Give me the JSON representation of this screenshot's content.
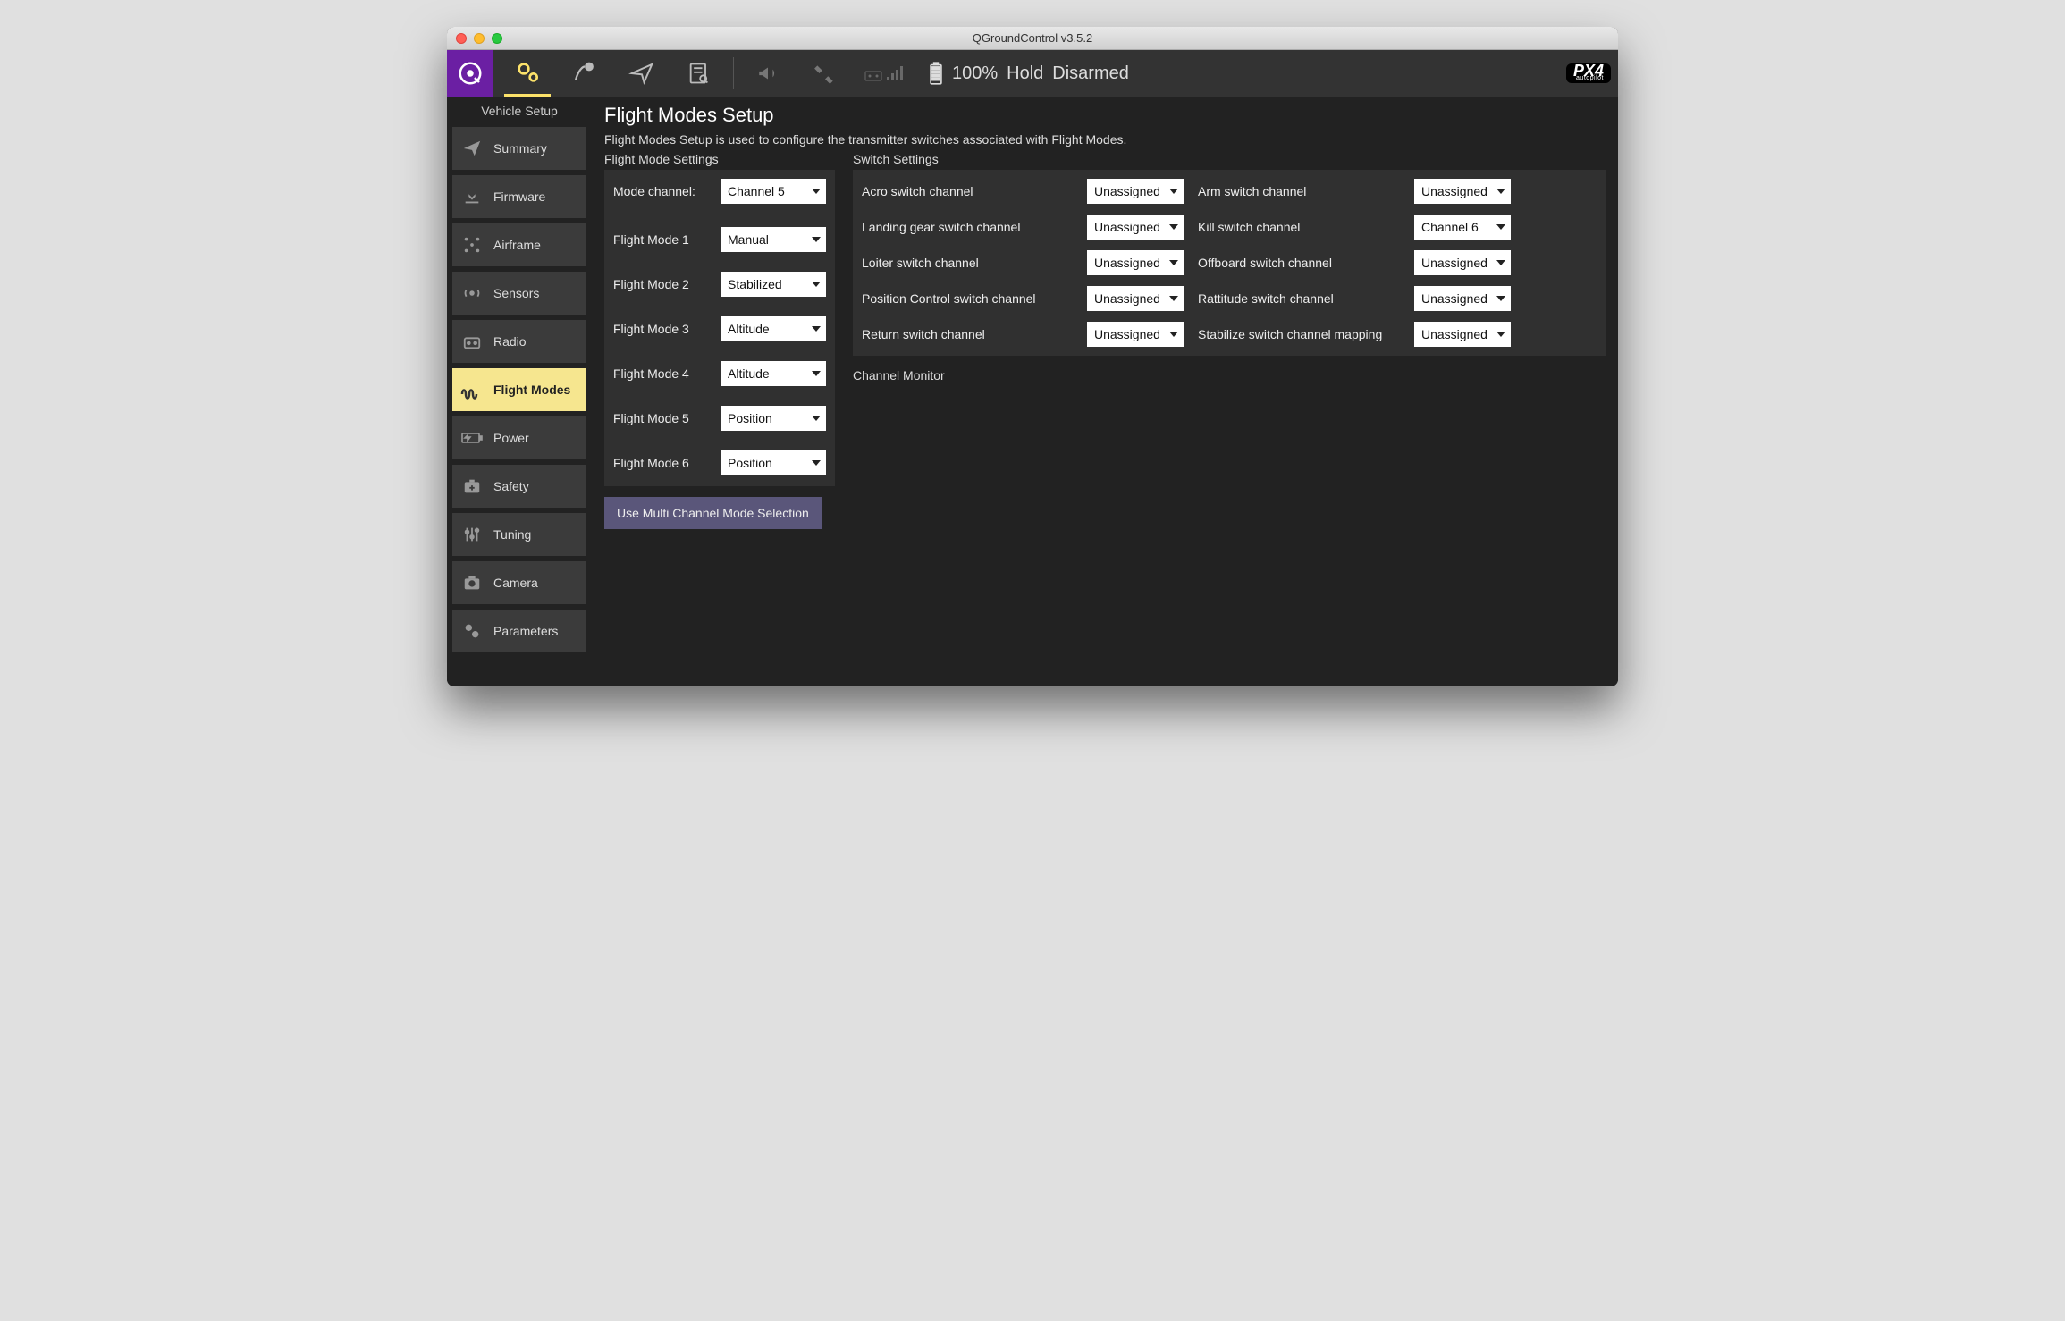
{
  "window": {
    "title": "QGroundControl v3.5.2"
  },
  "toolbar": {
    "battery": "100%",
    "status1": "Hold",
    "status2": "Disarmed",
    "brand": "PX4",
    "brand_sub": "autopilot"
  },
  "sidebar": {
    "title": "Vehicle Setup",
    "items": [
      {
        "label": "Summary"
      },
      {
        "label": "Firmware"
      },
      {
        "label": "Airframe"
      },
      {
        "label": "Sensors"
      },
      {
        "label": "Radio"
      },
      {
        "label": "Flight Modes"
      },
      {
        "label": "Power"
      },
      {
        "label": "Safety"
      },
      {
        "label": "Tuning"
      },
      {
        "label": "Camera"
      },
      {
        "label": "Parameters"
      }
    ],
    "active_index": 5
  },
  "page": {
    "title": "Flight Modes Setup",
    "description": "Flight Modes Setup is used to configure the transmitter switches associated with Flight Modes.",
    "flight_mode_section": "Flight Mode Settings",
    "switch_section": "Switch Settings",
    "channel_monitor": "Channel Monitor",
    "multi_button": "Use Multi Channel Mode Selection"
  },
  "flight_modes": {
    "channel_label": "Mode channel:",
    "channel_value": "Channel 5",
    "rows": [
      {
        "label": "Flight Mode 1",
        "value": "Manual"
      },
      {
        "label": "Flight Mode 2",
        "value": "Stabilized"
      },
      {
        "label": "Flight Mode 3",
        "value": "Altitude"
      },
      {
        "label": "Flight Mode 4",
        "value": "Altitude"
      },
      {
        "label": "Flight Mode 5",
        "value": "Position"
      },
      {
        "label": "Flight Mode 6",
        "value": "Position"
      }
    ]
  },
  "switches": [
    {
      "label": "Acro switch channel",
      "value": "Unassigned"
    },
    {
      "label": "Arm switch channel",
      "value": "Unassigned"
    },
    {
      "label": "Landing gear switch channel",
      "value": "Unassigned"
    },
    {
      "label": "Kill switch channel",
      "value": "Channel 6"
    },
    {
      "label": "Loiter switch channel",
      "value": "Unassigned"
    },
    {
      "label": "Offboard switch channel",
      "value": "Unassigned"
    },
    {
      "label": "Position Control switch channel",
      "value": "Unassigned"
    },
    {
      "label": "Rattitude switch channel",
      "value": "Unassigned"
    },
    {
      "label": "Return switch channel",
      "value": "Unassigned"
    },
    {
      "label": "Stabilize switch channel mapping",
      "value": "Unassigned"
    }
  ]
}
